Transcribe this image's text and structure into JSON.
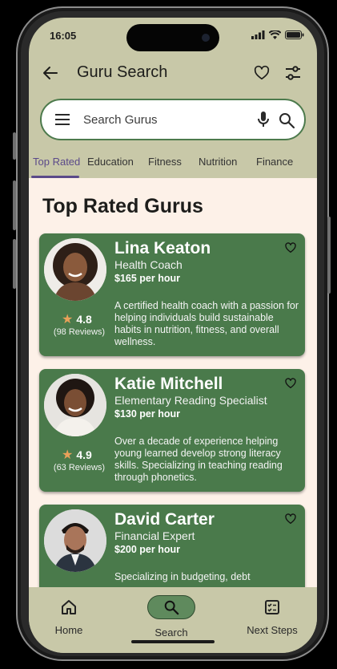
{
  "status": {
    "time": "16:05"
  },
  "appbar": {
    "title": "Guru Search"
  },
  "search": {
    "placeholder": "Search Gurus"
  },
  "tabs": [
    {
      "label": "Top Rated"
    },
    {
      "label": "Education"
    },
    {
      "label": "Fitness"
    },
    {
      "label": "Nutrition"
    },
    {
      "label": "Finance"
    }
  ],
  "section": {
    "heading": "Top Rated Gurus"
  },
  "gurus": [
    {
      "name": "Lina Keaton",
      "role": "Health Coach",
      "price": "$165 per hour",
      "rating": "4.8",
      "reviews": "(98 Reviews)",
      "description": "A certified health coach with a passion for helping individuals build sustainable habits in nutrition, fitness, and overall wellness."
    },
    {
      "name": "Katie Mitchell",
      "role": "Elementary Reading Specialist",
      "price": "$130 per hour",
      "rating": "4.9",
      "reviews": "(63 Reviews)",
      "description": "Over a decade of experience helping young learned develop strong literacy skills. Specializing in teaching reading through phonetics."
    },
    {
      "name": "David Carter",
      "role": "Financial Expert",
      "price": "$200 per hour",
      "rating": "",
      "reviews": "",
      "description": "Specializing in budgeting, debt"
    }
  ],
  "bottom_nav": [
    {
      "label": "Home",
      "icon": "home-icon"
    },
    {
      "label": "Search",
      "icon": "search-icon",
      "active": true
    },
    {
      "label": "Next Steps",
      "icon": "checklist-icon"
    }
  ],
  "colors": {
    "card": "#4a7a4b",
    "accent": "#5b4a8a",
    "background": "#fdf1e8",
    "chrome": "#c8c8a8",
    "star": "#e9a15a"
  }
}
